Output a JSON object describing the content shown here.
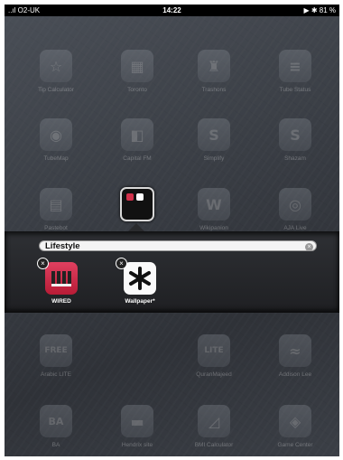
{
  "status_bar": {
    "carrier": "..ıl O2-UK",
    "time": "14:22",
    "battery": "81 %"
  },
  "apps": [
    {
      "label": "Tip Calculator",
      "glyph": "☆"
    },
    {
      "label": "Toronto",
      "glyph": "▦"
    },
    {
      "label": "Trashons",
      "glyph": "♜"
    },
    {
      "label": "Tube Status",
      "glyph": "≡"
    },
    {
      "label": "TubeMap",
      "glyph": "◉"
    },
    {
      "label": "Capital FM",
      "glyph": "◧"
    },
    {
      "label": "Simplify",
      "glyph": "S"
    },
    {
      "label": "Shazam",
      "glyph": "S"
    },
    {
      "label": "Pastebot",
      "glyph": "▤"
    },
    {
      "label": "Wikipanion",
      "glyph": "W"
    },
    {
      "label": "AJA Live",
      "glyph": "◎"
    },
    {
      "label": "Arabic LITE",
      "glyph": "FREE"
    },
    {
      "label": "QuranMajeed",
      "glyph": "LITE"
    },
    {
      "label": "Addison Lee",
      "glyph": "≈"
    },
    {
      "label": "BA",
      "glyph": "BA"
    },
    {
      "label": "Hendrix site",
      "glyph": "▬"
    },
    {
      "label": "BMI Calculator",
      "glyph": "◿"
    },
    {
      "label": "Game Center",
      "glyph": "◈"
    }
  ],
  "folder": {
    "name": "Lifestyle",
    "apps": [
      {
        "label": "WIRED",
        "color": "#c8223c"
      },
      {
        "label": "Wallpaper*",
        "color": "#ffffff"
      }
    ]
  }
}
